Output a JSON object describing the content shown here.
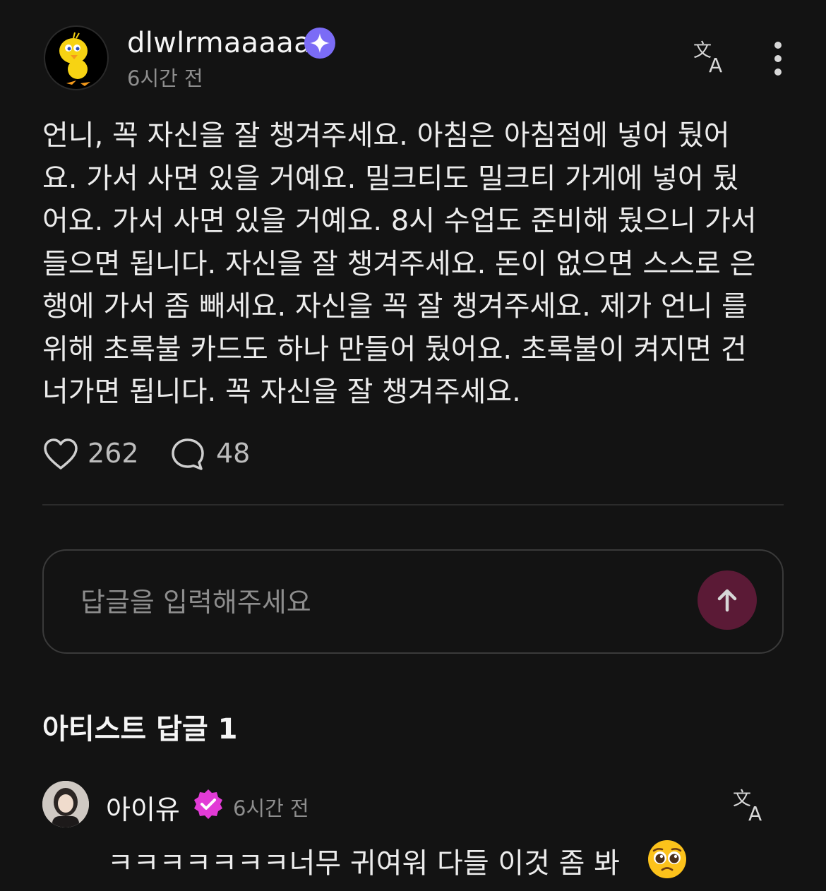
{
  "post": {
    "username": "dlwlrmaaaaa",
    "time": "6시간 전",
    "text": "언니, 꼭 자신을 잘 챙겨주세요. 아침은 아침점에 넣어 뒀어\n요. 가서 사면 있을 거예요. 밀크티도 밀크티 가게에 넣어 뒀\n어요. 가서 사면 있을 거예요. 8시 수업도 준비해 뒀으니 가서\n들으면 됩니다. 자신을 잘 챙겨주세요. 돈이 없으면 스스로 은\n행에 가서 좀 빼세요. 자신을 꼭 잘 챙겨주세요. 제가 언니 를\n위해 초록불 카드도 하나 만들어 뒀어요. 초록불이 켜지면 건\n너가면 됩니다. 꼭 자신을 잘 챙겨주세요.",
    "likes": "262",
    "comments": "48"
  },
  "reply": {
    "placeholder": "답글을 입력해주세요"
  },
  "artist_section": {
    "title": "아티스트 답글 1"
  },
  "artist_comment": {
    "name": "아이유",
    "time": "6시간 전",
    "text": "ㅋㅋㅋㅋㅋㅋㅋ너무 귀여워 다들 이것 좀 봐",
    "emoji": "pleading-face-emoji"
  },
  "colors": {
    "background": "#131313",
    "membership_badge": "#7b6cf6",
    "artist_badge": "#e23bd6",
    "send_button": "#5b1a36"
  },
  "icons": [
    "star-badge-icon",
    "translate-icon",
    "more-vertical-icon",
    "heart-icon",
    "comment-icon",
    "arrow-up-icon",
    "verified-check-icon"
  ]
}
